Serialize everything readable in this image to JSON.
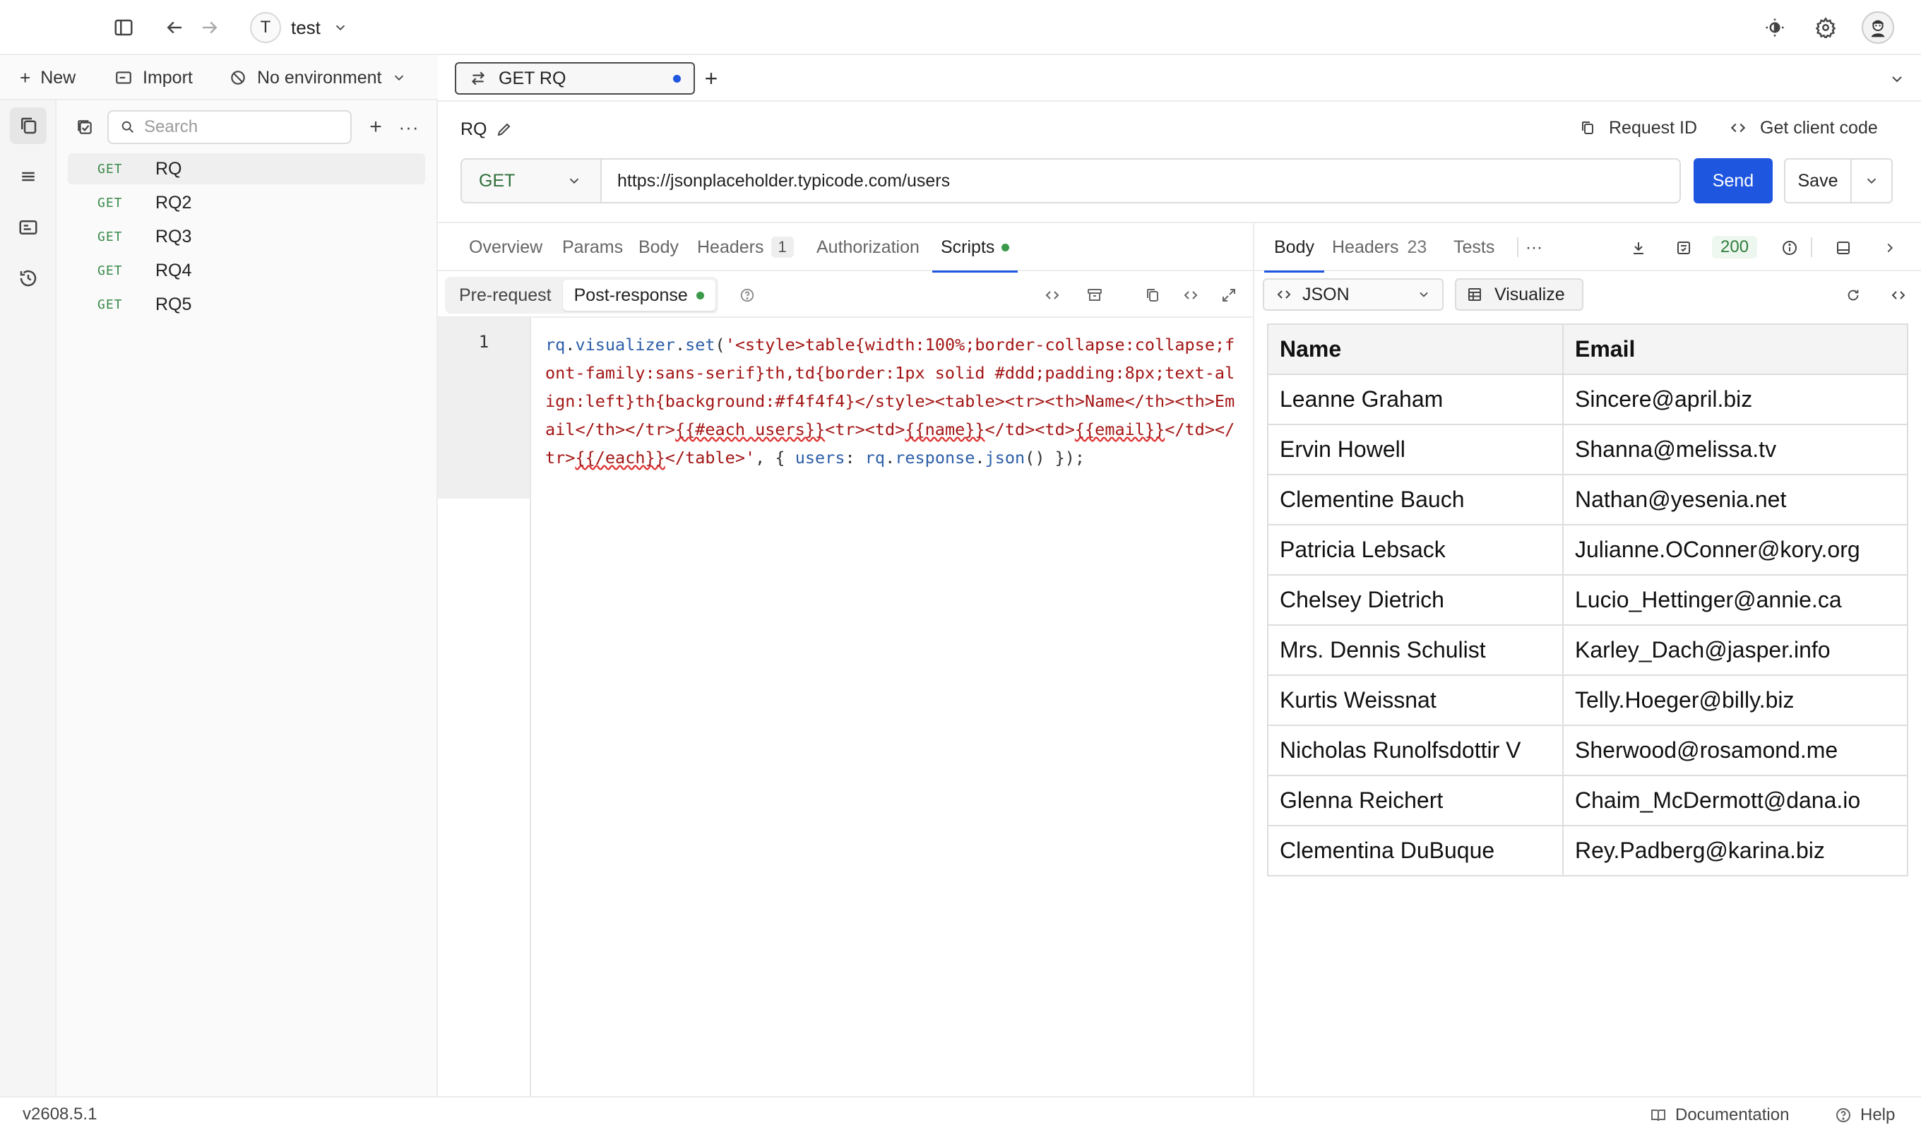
{
  "workspace": {
    "initial": "T",
    "name": "test"
  },
  "toolbar": {
    "new_label": "New",
    "import_label": "Import",
    "environment_label": "No environment"
  },
  "sidebar": {
    "search_placeholder": "Search",
    "requests": [
      {
        "method": "GET",
        "name": "RQ"
      },
      {
        "method": "GET",
        "name": "RQ2"
      },
      {
        "method": "GET",
        "name": "RQ3"
      },
      {
        "method": "GET",
        "name": "RQ4"
      },
      {
        "method": "GET",
        "name": "RQ5"
      }
    ]
  },
  "tab": {
    "label": "GET RQ",
    "dirty_color": "#1e56e0"
  },
  "request": {
    "title": "RQ",
    "request_id_label": "Request ID",
    "client_code_label": "Get client code",
    "method": "GET",
    "url": "https://jsonplaceholder.typicode.com/users",
    "send_label": "Send",
    "save_label": "Save"
  },
  "section_tabs": {
    "overview": "Overview",
    "params": "Params",
    "body": "Body",
    "headers": "Headers",
    "headers_count": "1",
    "authorization": "Authorization",
    "scripts": "Scripts"
  },
  "script_tabs": {
    "pre": "Pre-request",
    "post": "Post-response"
  },
  "editor": {
    "line_number": "1",
    "tokens": {
      "rq1": "rq",
      "dot1": ".",
      "visualizer": "visualizer",
      "dot2": ".",
      "set": "set",
      "open_paren": "(",
      "str1": "'<style>table{width:100%;border-collapse:collapse;font-family:sans-serif}th,td{border:1px solid #ddd;padding:8px;text-align:left}th{background:#f4f4f4}</style><table><tr><th>Name</th><th>Email</th></tr>",
      "each_open": "{{#each users}}",
      "str2": "<tr><td>",
      "name_tpl": "{{name}}",
      "str3": "</td><td>",
      "email_tpl": "{{email}}",
      "str4": "</td></tr>",
      "each_close": "{{/each}}",
      "str5": "</table>'",
      "punct1": ", { ",
      "users_key": "users",
      "colon": ": ",
      "rq2": "rq",
      "dot3": ".",
      "response": "response",
      "dot4": ".",
      "json": "json",
      "punct2": "() });"
    }
  },
  "response": {
    "tabs": {
      "body": "Body",
      "headers": "Headers",
      "headers_count": "23",
      "tests": "Tests"
    },
    "status_code": "200",
    "format": "JSON",
    "visualize_label": "Visualize",
    "table": {
      "headers": [
        "Name",
        "Email"
      ],
      "rows": [
        [
          "Leanne Graham",
          "Sincere@april.biz"
        ],
        [
          "Ervin Howell",
          "Shanna@melissa.tv"
        ],
        [
          "Clementine Bauch",
          "Nathan@yesenia.net"
        ],
        [
          "Patricia Lebsack",
          "Julianne.OConner@kory.org"
        ],
        [
          "Chelsey Dietrich",
          "Lucio_Hettinger@annie.ca"
        ],
        [
          "Mrs. Dennis Schulist",
          "Karley_Dach@jasper.info"
        ],
        [
          "Kurtis Weissnat",
          "Telly.Hoeger@billy.biz"
        ],
        [
          "Nicholas Runolfsdottir V",
          "Sherwood@rosamond.me"
        ],
        [
          "Glenna Reichert",
          "Chaim_McDermott@dana.io"
        ],
        [
          "Clementina DuBuque",
          "Rey.Padberg@karina.biz"
        ]
      ]
    }
  },
  "footer": {
    "version": "v2608.5.1",
    "documentation": "Documentation",
    "help": "Help"
  },
  "colors": {
    "accent": "#1e56e0",
    "success": "#3a9a4a",
    "method_get": "#3a8a4a"
  }
}
